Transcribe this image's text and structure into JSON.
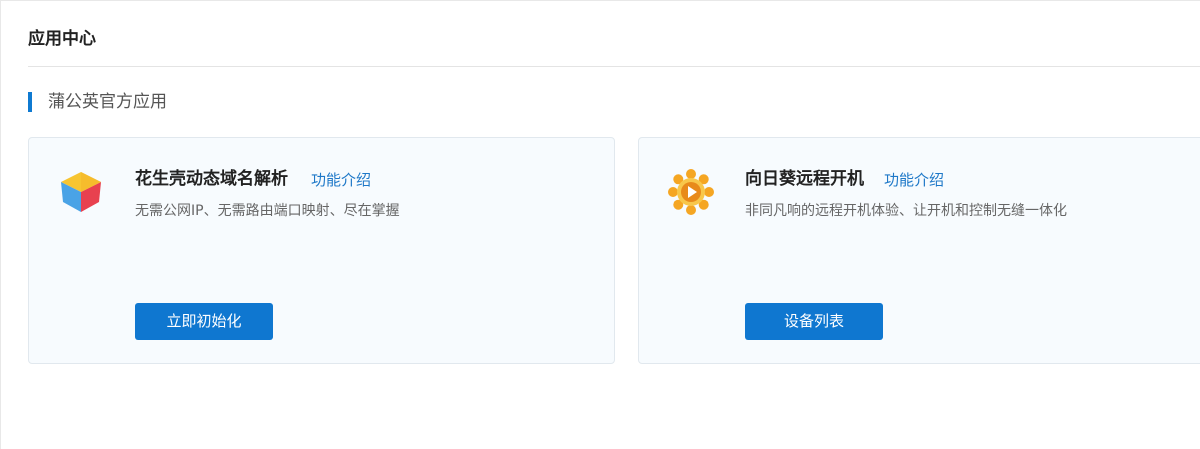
{
  "page": {
    "title": "应用中心"
  },
  "section": {
    "title": "蒲公英官方应用"
  },
  "apps": [
    {
      "name": "花生壳动态域名解析",
      "link_label": "功能介绍",
      "description": "无需公网IP、无需路由端口映射、尽在掌握",
      "button_label": "立即初始化",
      "icon": "peanut-shell-cube-icon"
    },
    {
      "name": "向日葵远程开机",
      "link_label": "功能介绍",
      "description": "非同凡响的远程开机体验、让开机和控制无缝一体化",
      "button_label": "设备列表",
      "icon": "sunflower-icon"
    }
  ],
  "colors": {
    "accent": "#0f77d0",
    "link": "#1e78c8",
    "card_bg": "#f7fbfe"
  }
}
